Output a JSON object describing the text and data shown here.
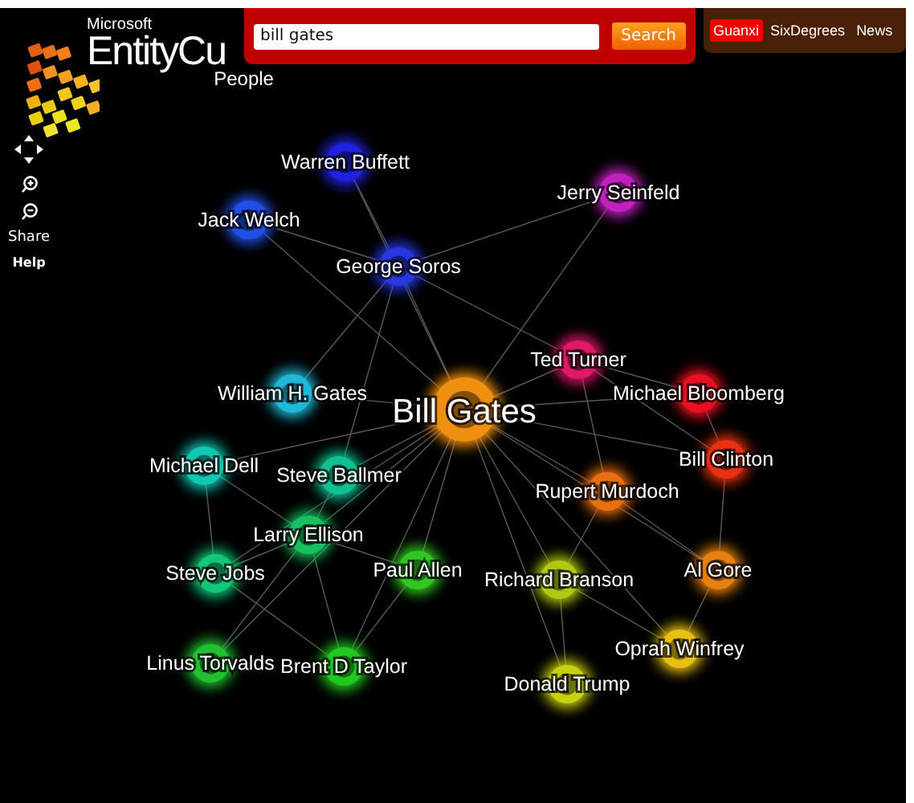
{
  "logo": {
    "brand": "Microsoft",
    "product": "EntityCu",
    "section": "People"
  },
  "search": {
    "value": "bill gates",
    "button": "Search"
  },
  "nav": [
    {
      "label": "Guanxi",
      "selected": true
    },
    {
      "label": "SixDegrees",
      "selected": false
    },
    {
      "label": "News",
      "selected": false
    }
  ],
  "tools": {
    "share": "Share",
    "help": "Help"
  },
  "nodes": [
    {
      "name": "Warren Buffett",
      "kind": "person",
      "color": "#2020e0"
    },
    {
      "name": "Jack Welch",
      "kind": "person",
      "color": "#2050e8"
    },
    {
      "name": "Jerry Seinfeld",
      "kind": "person",
      "color": "#c020c0"
    },
    {
      "name": "George Soros",
      "kind": "person",
      "color": "#2838e0"
    },
    {
      "name": "Ted Turner",
      "kind": "person",
      "color": "#e01868"
    },
    {
      "name": "William H. Gates",
      "kind": "person",
      "color": "#20b8d8"
    },
    {
      "name": "Bill Gates",
      "kind": "center",
      "color": "#f09010"
    },
    {
      "name": "Michael Bloomberg",
      "kind": "person",
      "color": "#e81020"
    },
    {
      "name": "Michael Dell",
      "kind": "person",
      "color": "#10c8b0"
    },
    {
      "name": "Steve Ballmer",
      "kind": "person",
      "color": "#10c090"
    },
    {
      "name": "Bill Clinton",
      "kind": "person",
      "color": "#e83010"
    },
    {
      "name": "Rupert Murdoch",
      "kind": "person",
      "color": "#e87010"
    },
    {
      "name": "Larry Ellison",
      "kind": "person",
      "color": "#18c060"
    },
    {
      "name": "Steve Jobs",
      "kind": "person",
      "color": "#10c878"
    },
    {
      "name": "Paul Allen",
      "kind": "person",
      "color": "#30c820"
    },
    {
      "name": "Richard Branson",
      "kind": "person",
      "color": "#b0c810"
    },
    {
      "name": "Al Gore",
      "kind": "person",
      "color": "#e88010"
    },
    {
      "name": "Oprah Winfrey",
      "kind": "person",
      "color": "#e8c010"
    },
    {
      "name": "Linus Torvalds",
      "kind": "person",
      "color": "#20c030"
    },
    {
      "name": "Brent D Taylor",
      "kind": "person",
      "color": "#20c820"
    },
    {
      "name": "Donald Trump",
      "kind": "person",
      "color": "#c8d010"
    }
  ]
}
